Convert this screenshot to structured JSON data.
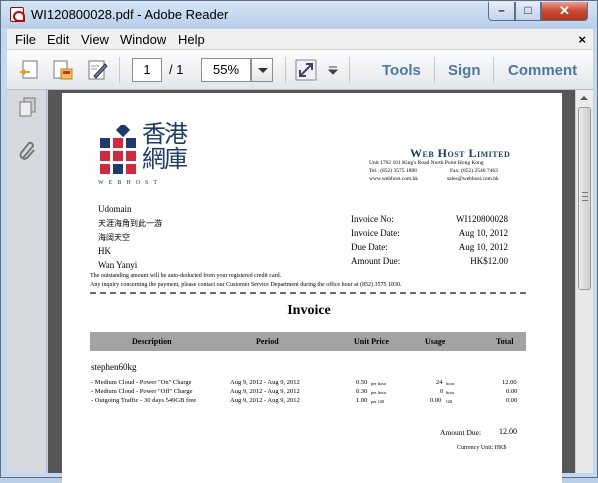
{
  "window": {
    "title": "WI120800028.pdf - Adobe Reader",
    "min": "–",
    "max": "□",
    "close": "✕"
  },
  "menu": {
    "file": "File",
    "edit": "Edit",
    "view": "View",
    "window": "Window",
    "help": "Help",
    "close_doc": "×"
  },
  "toolbar": {
    "page_current": "1",
    "page_total": "/ 1",
    "zoom": "55%",
    "tools": "Tools",
    "sign": "Sign",
    "comment": "Comment"
  },
  "icons": [
    "create-pdf-icon",
    "export-icon",
    "edit-icon",
    "fit-page-icon",
    "menu-arrow-icon",
    "pages-icon",
    "attachment-icon"
  ],
  "invoice": {
    "logo_cn": "香港網庫",
    "logo_en": "WEBHOST",
    "company": "Web Host Limited",
    "address": "Unit 1702 101 King's Road North Point Hong Kong",
    "tel": "Tel.: (852) 3575 1888",
    "fax": "Fax: (852) 2540 7463",
    "web": "www.webhost.com.hk",
    "email": "sales@webhost.com.hk",
    "customer": [
      "Udomain",
      "天涯海角到此一游",
      "海阔天空",
      "HK",
      "Wan Yanyi"
    ],
    "meta": [
      {
        "label": "Invoice No:",
        "value": "WI120800028"
      },
      {
        "label": "Invoice Date:",
        "value": "Aug 10, 2012"
      },
      {
        "label": "Due Date:",
        "value": "Aug 10, 2012"
      },
      {
        "label": "Amount Due:",
        "value": "HK$12.00"
      }
    ],
    "note1": "The outstanding amount will be auto-deducted from your registered credit card.",
    "note2": "Any inquiry concerning the payment, please contact our Customer Service Department during the office hour at (852) 3575 1830.",
    "heading": "Invoice",
    "columns": {
      "description": "Description",
      "period": "Period",
      "unit_price": "Unit Price",
      "usage": "Usage",
      "total": "Total"
    },
    "account": "stephen60kg",
    "lines": [
      {
        "desc": "- Medium Cloud - Power \"On\" Charge",
        "period": "Aug 9, 2012 - Aug 9, 2012",
        "price": "0.50",
        "price_unit": "per hour",
        "usage": "24",
        "usage_unit": "hour",
        "total": "12.00"
      },
      {
        "desc": "- Medium Cloud - Power \"Off\" Charge",
        "period": "Aug 9, 2012 - Aug 9, 2012",
        "price": "0.30",
        "price_unit": "per hour",
        "usage": "0",
        "usage_unit": "hour",
        "total": "0.00"
      },
      {
        "desc": "- Outgoing Traffic - 30 days 549GB free",
        "period": "Aug 9, 2012 - Aug 9, 2012",
        "price": "1.00",
        "price_unit": "per GB",
        "usage": "0.00",
        "usage_unit": "GB",
        "total": "0.00"
      }
    ],
    "amount_due_label": "Amount Due:",
    "amount_due_value": "12.00",
    "currency_unit": "Currency Unit: HK$"
  },
  "colors": {
    "logo_blue": "#1b3d6e",
    "logo_red": "#d6283c",
    "accent": "#4b78a6"
  }
}
